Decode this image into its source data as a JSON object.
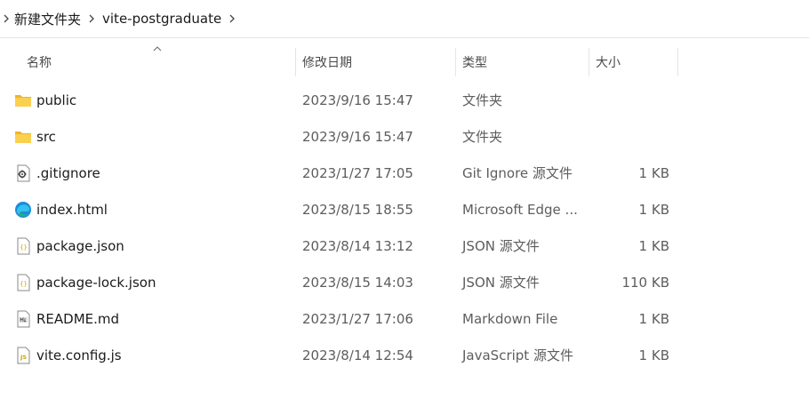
{
  "breadcrumb": {
    "items": [
      "新建文件夹",
      "vite-postgraduate"
    ]
  },
  "columns": {
    "name": "名称",
    "date": "修改日期",
    "type": "类型",
    "size": "大小"
  },
  "files": [
    {
      "name": "public",
      "date": "2023/9/16 15:47",
      "type": "文件夹",
      "size": "",
      "icon": "folder-icon"
    },
    {
      "name": "src",
      "date": "2023/9/16 15:47",
      "type": "文件夹",
      "size": "",
      "icon": "folder-icon"
    },
    {
      "name": ".gitignore",
      "date": "2023/1/27 17:05",
      "type": "Git Ignore 源文件",
      "size": "1 KB",
      "icon": "config-file-icon"
    },
    {
      "name": "index.html",
      "date": "2023/8/15 18:55",
      "type": "Microsoft Edge ...",
      "size": "1 KB",
      "icon": "edge-icon"
    },
    {
      "name": "package.json",
      "date": "2023/8/14 13:12",
      "type": "JSON 源文件",
      "size": "1 KB",
      "icon": "json-file-icon"
    },
    {
      "name": "package-lock.json",
      "date": "2023/8/15 14:03",
      "type": "JSON 源文件",
      "size": "110 KB",
      "icon": "json-file-icon"
    },
    {
      "name": "README.md",
      "date": "2023/1/27 17:06",
      "type": "Markdown File",
      "size": "1 KB",
      "icon": "markdown-file-icon"
    },
    {
      "name": "vite.config.js",
      "date": "2023/8/14 12:54",
      "type": "JavaScript 源文件",
      "size": "1 KB",
      "icon": "js-file-icon"
    }
  ],
  "colors": {
    "folder": "#f8c94a",
    "edge": "#1a8fd8",
    "json": "#c8a400",
    "js": "#c8a400"
  }
}
